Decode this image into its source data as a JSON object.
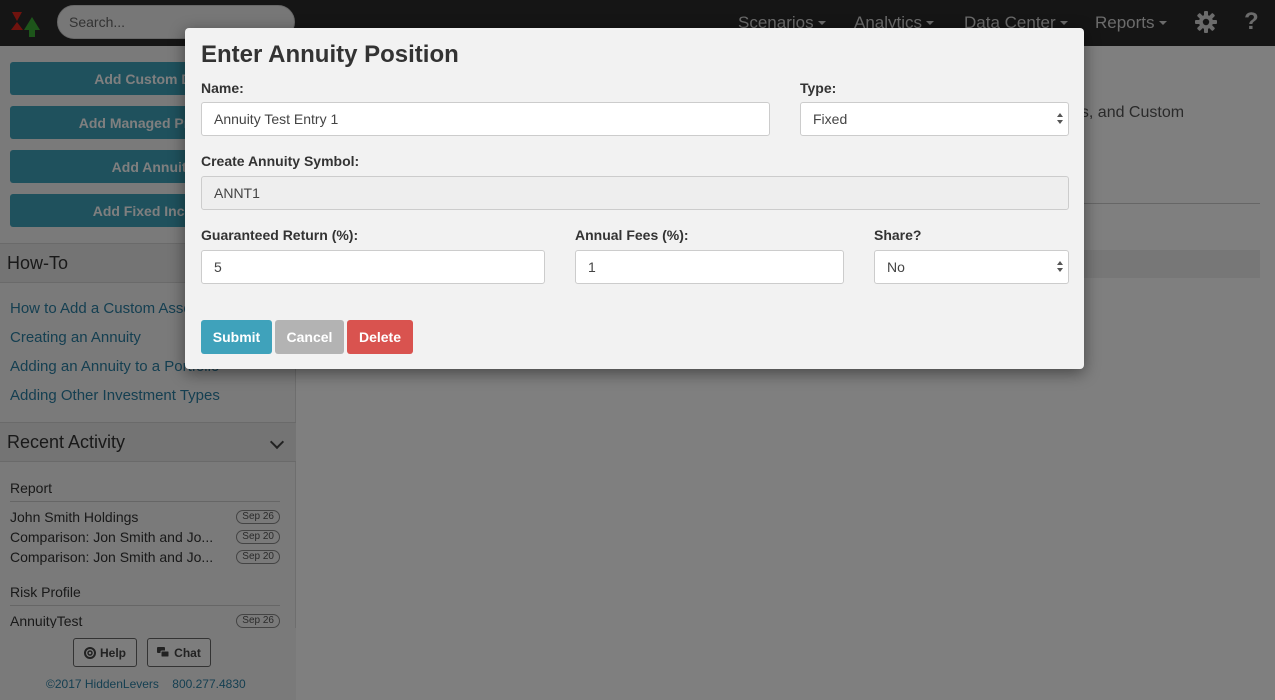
{
  "nav": {
    "search_placeholder": "Search...",
    "menu": [
      {
        "label": "Scenarios"
      },
      {
        "label": "Analytics"
      },
      {
        "label": "Data Center"
      },
      {
        "label": "Reports"
      }
    ],
    "help_glyph": "?"
  },
  "sidebar": {
    "add_buttons": [
      {
        "label": "Add Custom Data"
      },
      {
        "label": "Add Managed Product"
      },
      {
        "label": "Add Annuity"
      },
      {
        "label": "Add Fixed Income"
      }
    ],
    "howto": {
      "title": "How-To",
      "links": [
        {
          "label": "How to Add a Custom Asset"
        },
        {
          "label": "Creating an Annuity"
        },
        {
          "label": "Adding an Annuity to a Portfolio"
        },
        {
          "label": "Adding Other Investment Types"
        }
      ]
    },
    "recent": {
      "title": "Recent Activity",
      "groups": [
        {
          "category": "Report",
          "items": [
            {
              "label": "John Smith Holdings",
              "date": "Sep 26"
            },
            {
              "label": "Comparison: Jon Smith and Jo...",
              "date": "Sep 20"
            },
            {
              "label": "Comparison: Jon Smith and Jo...",
              "date": "Sep 20"
            }
          ]
        },
        {
          "category": "Risk Profile",
          "items": [
            {
              "label": "AnnuityTest",
              "date": "Sep 26"
            }
          ]
        }
      ]
    },
    "footer": {
      "help_label": "Help",
      "chat_label": "Chat",
      "copyright": "©2017 HiddenLevers",
      "phone": "800.277.4830"
    }
  },
  "main": {
    "partial_text": "ties, and Custom"
  },
  "modal": {
    "title": "Enter Annuity Position",
    "name": {
      "label": "Name:",
      "value": "Annuity Test Entry 1"
    },
    "type": {
      "label": "Type:",
      "value": "Fixed"
    },
    "symbol": {
      "label": "Create Annuity Symbol:",
      "value": "ANNT1"
    },
    "guaranteed_return": {
      "label": "Guaranteed Return (%):",
      "value": "5"
    },
    "annual_fees": {
      "label": "Annual Fees (%):",
      "value": "1"
    },
    "share": {
      "label": "Share?",
      "value": "No"
    },
    "buttons": {
      "submit": "Submit",
      "cancel": "Cancel",
      "delete": "Delete"
    }
  },
  "colors": {
    "topbar": "#2b2b2b",
    "accent": "#3fa2bb",
    "link": "#2a7fa3",
    "cancel": "#b3b3b3",
    "delete": "#d9534f"
  }
}
